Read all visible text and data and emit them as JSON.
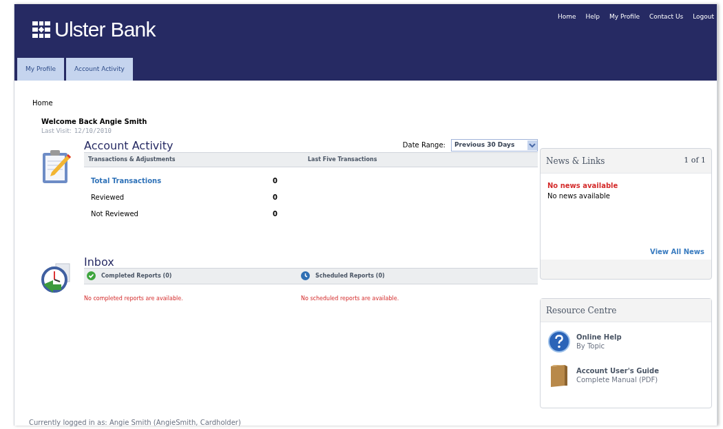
{
  "header": {
    "logo": "Ulster Bank",
    "links": [
      "Home",
      "Help",
      "My Profile",
      "Contact Us",
      "Logout"
    ]
  },
  "tabs": [
    {
      "label": "My Profile",
      "selected": false
    },
    {
      "label": "Account Activity",
      "selected": false
    }
  ],
  "breadcrumb": "Home",
  "welcome": {
    "title": "Welcome Back Angie Smith",
    "last_visit_label": "Last Visit:",
    "last_visit": "12/10/2010"
  },
  "account_activity": {
    "title": "Account Activity",
    "date_range_label": "Date Range:",
    "date_range": "Previous 30 Days",
    "columns": [
      "Transactions & Adjustments",
      "Last Five Transactions"
    ],
    "rows": [
      {
        "label": "Total Transactions",
        "value": "0",
        "kind": "link"
      },
      {
        "label": "Reviewed",
        "value": "0",
        "kind": "text"
      },
      {
        "label": "Not Reviewed",
        "value": "0",
        "kind": "text"
      }
    ]
  },
  "inbox": {
    "title": "Inbox",
    "columns": [
      {
        "label": "Completed Reports (0)",
        "kind": "completed",
        "message": "No completed reports are available."
      },
      {
        "label": "Scheduled Reports (0)",
        "kind": "scheduled",
        "message": "No scheduled reports are available."
      }
    ]
  },
  "news": {
    "title": "News & Links",
    "pager": "1 of 1",
    "headline": "No news available",
    "text": "No news available",
    "link": "View All News"
  },
  "resources": {
    "title": "Resource Centre",
    "items": [
      {
        "kind": "help",
        "title": "Online Help",
        "subtitle": "By Topic"
      },
      {
        "kind": "guide",
        "title": "Account User's Guide",
        "subtitle": "Complete Manual (PDF)"
      }
    ]
  },
  "footer": "Currently logged in as: Angie Smith (AngieSmith, Cardholder)"
}
